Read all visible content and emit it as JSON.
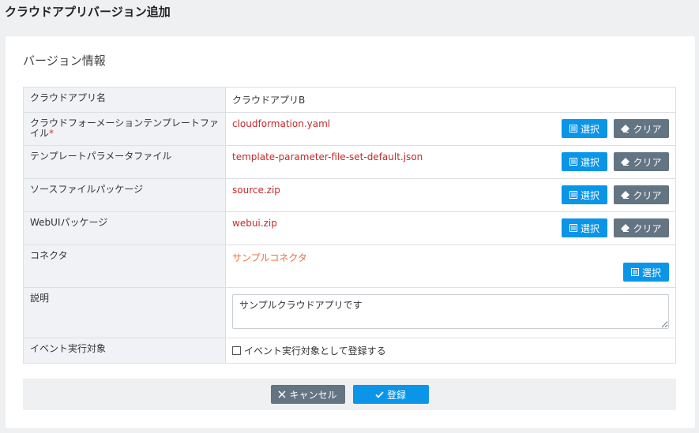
{
  "page": {
    "title": "クラウドアプリバージョン追加"
  },
  "section": {
    "title": "バージョン情報"
  },
  "rows": {
    "app_name": {
      "label": "クラウドアプリ名",
      "value": "クラウドアプリB"
    },
    "cf_template": {
      "label": "クラウドフォーメーションテンプレートファイル",
      "required_mark": "*",
      "value": "cloudformation.yaml"
    },
    "template_params": {
      "label": "テンプレートパラメータファイル",
      "value": "template-parameter-file-set-default.json"
    },
    "source_package": {
      "label": "ソースファイルパッケージ",
      "value": "source.zip"
    },
    "webui_package": {
      "label": "WebUIパッケージ",
      "value": "webui.zip"
    },
    "connector": {
      "label": "コネクタ",
      "value": "サンプルコネクタ"
    },
    "description": {
      "label": "説明",
      "value": "サンプルクラウドアプリです"
    },
    "event_target": {
      "label": "イベント実行対象",
      "checkbox_label": "イベント実行対象として登録する",
      "checked": false
    }
  },
  "buttons": {
    "select": "選択",
    "clear": "クリア",
    "cancel": "キャンセル",
    "register": "登録"
  },
  "icons": {
    "select": "list-icon",
    "clear": "eraser-icon",
    "cancel": "close-icon",
    "register": "check-icon"
  },
  "colors": {
    "primary": "#0a95e8",
    "secondary": "#637483",
    "file_text": "#c62828",
    "connector_text": "#e8703a",
    "required": "#d9342b"
  }
}
